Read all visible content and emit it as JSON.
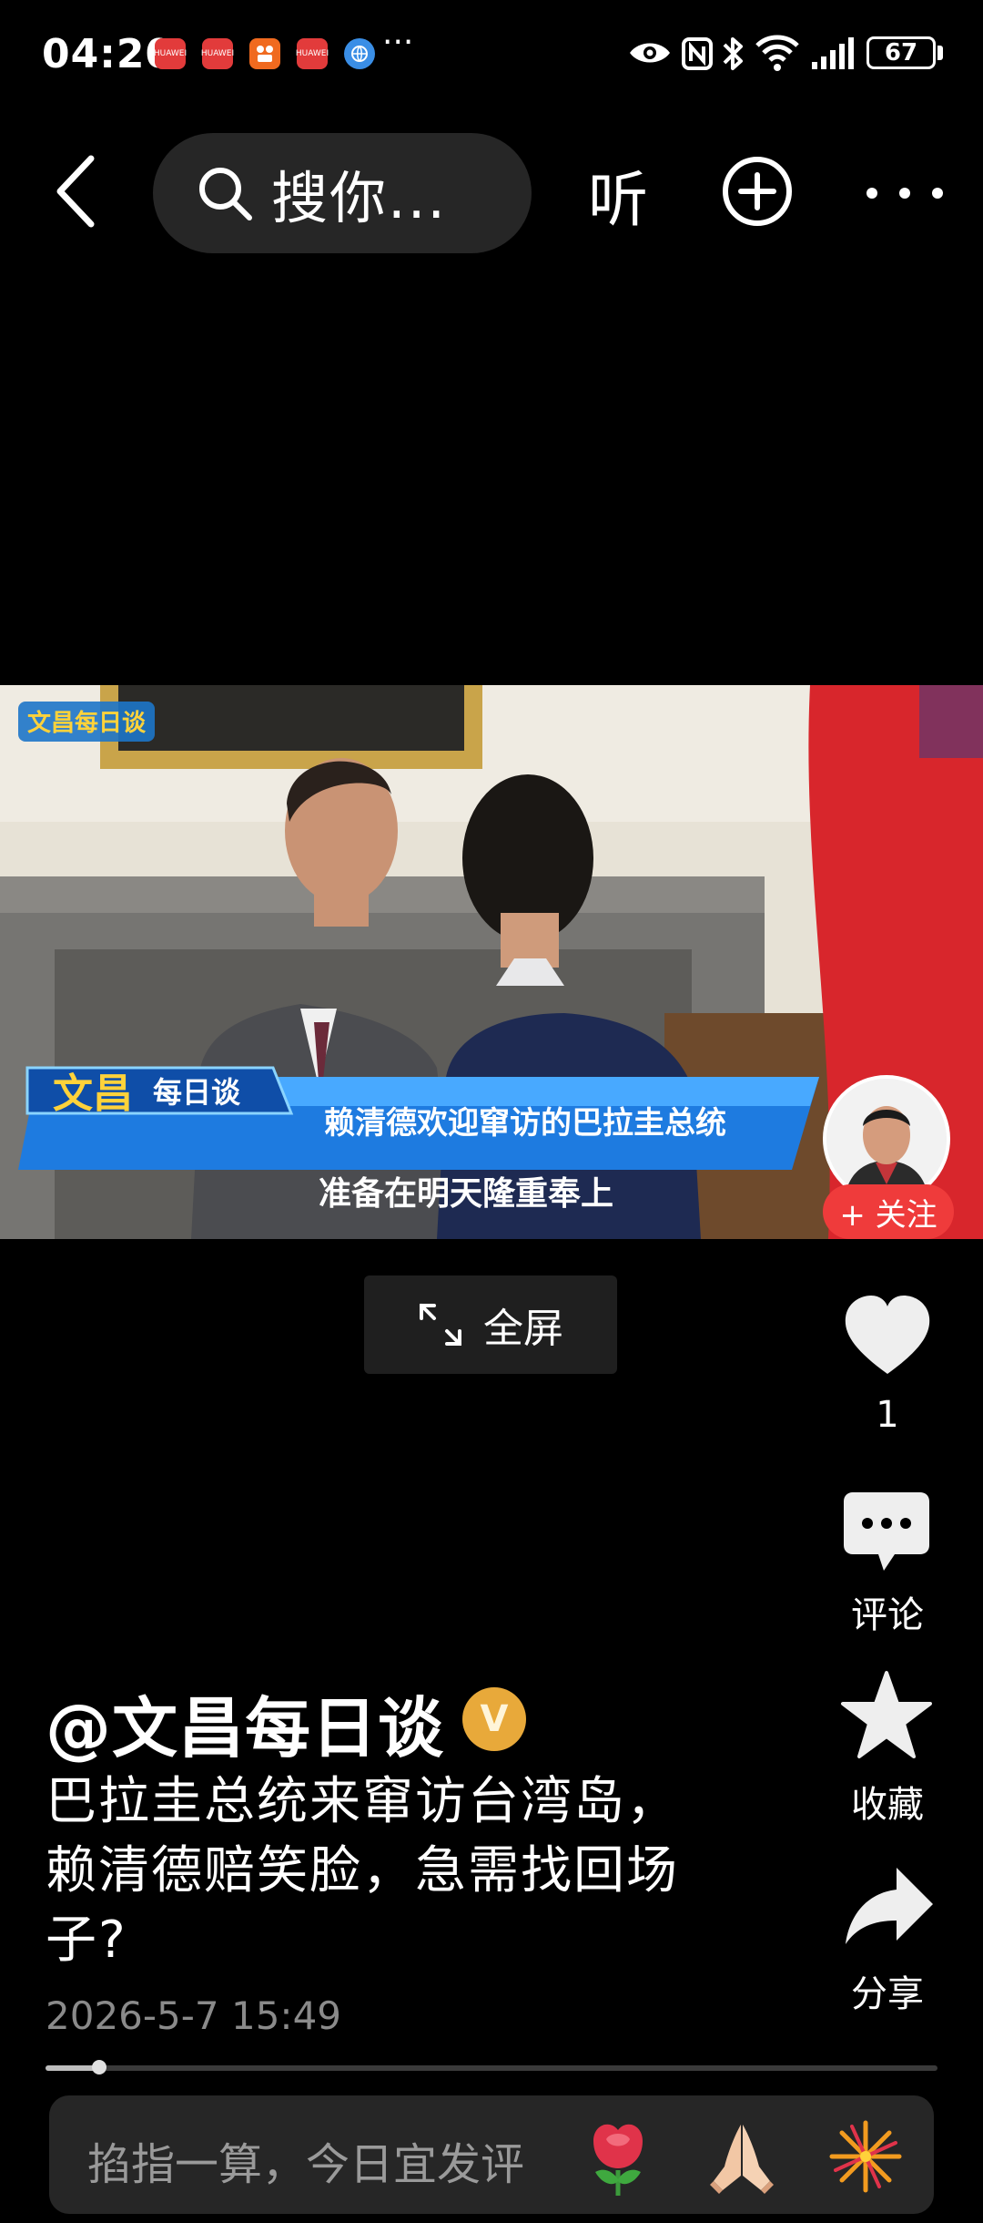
{
  "status_bar": {
    "time": "04:20",
    "app_icons": [
      {
        "name": "huawei-app-icon",
        "label": "HUAWEI",
        "color": "#e23b3b"
      },
      {
        "name": "huawei-app-icon",
        "label": "HUAWEI",
        "color": "#e23b3b"
      },
      {
        "name": "kuaishou-app-icon",
        "label": "",
        "color": "#f06a1f"
      },
      {
        "name": "huawei-app-icon",
        "label": "HUAWEI",
        "color": "#e23b3b"
      },
      {
        "name": "browser-app-icon",
        "label": "",
        "color": "#3a8ee6"
      }
    ],
    "more": "···",
    "battery": "67"
  },
  "top_bar": {
    "search_text": "搜你...",
    "listen_label": "听"
  },
  "video": {
    "logo_text": "文昌每日谈",
    "caption_line1": "赖清德欢迎窜访的巴拉圭总统",
    "caption_line2": "准备在明天隆重奉上",
    "follow_label": "+ 关注",
    "fullscreen_label": "全屏"
  },
  "actions": {
    "like_count": "1",
    "comment_label": "评论",
    "favorite_label": "收藏",
    "share_label": "分享"
  },
  "post": {
    "author": "@文昌每日谈",
    "verified_mark": "V",
    "description": "巴拉圭总统来窜访台湾岛，赖清德赔笑脸，急需找回场子?",
    "date": "2026-5-7 15:49",
    "progress": 0.06
  },
  "comment_bar": {
    "placeholder": "掐指一算，今日宜发评"
  },
  "colors": {
    "background": "#000000",
    "accent_red": "#ef3b3b",
    "verified_gold": "#e8a93a"
  }
}
